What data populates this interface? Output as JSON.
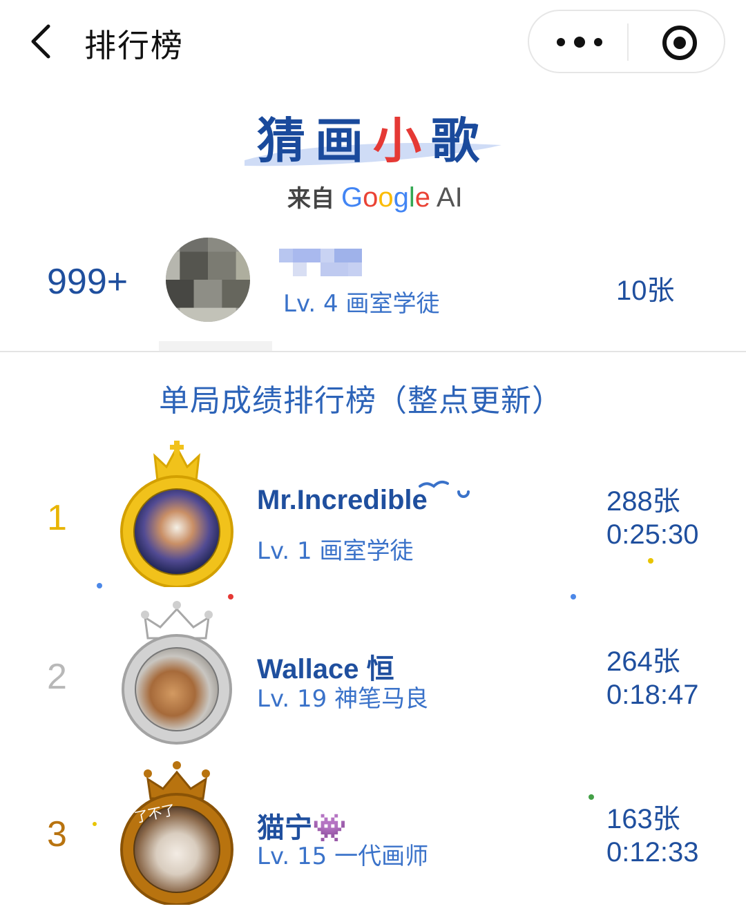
{
  "header": {
    "title": "排行榜",
    "back_icon": "chevron-left-icon",
    "more_icon": "more-dots-icon",
    "close_icon": "target-close-icon"
  },
  "logo": {
    "chars": [
      "猜",
      "画",
      "小",
      "歌"
    ],
    "from": "来自",
    "brand": "Google AI"
  },
  "me": {
    "rank": "999+",
    "level": "Lv. 4 画室学徒",
    "count": "10张"
  },
  "board": {
    "title": "单局成绩排行榜（整点更新）",
    "entries": [
      {
        "rank": "1",
        "name": "Mr.Incredible",
        "level": "Lv. 1 画室学徒",
        "count": "288张",
        "time": "0:25:30",
        "rank_color": "#e8b400"
      },
      {
        "rank": "2",
        "name": "Wallace 恒",
        "level": "Lv. 19 神笔马良",
        "count": "264张",
        "time": "0:18:47",
        "rank_color": "#b8b8b8"
      },
      {
        "rank": "3",
        "name": "猫宁👾",
        "level": "Lv. 15 一代画师",
        "count": "163张",
        "time": "0:12:33",
        "rank_color": "#b8730f"
      }
    ]
  },
  "badge_text": "了不了"
}
